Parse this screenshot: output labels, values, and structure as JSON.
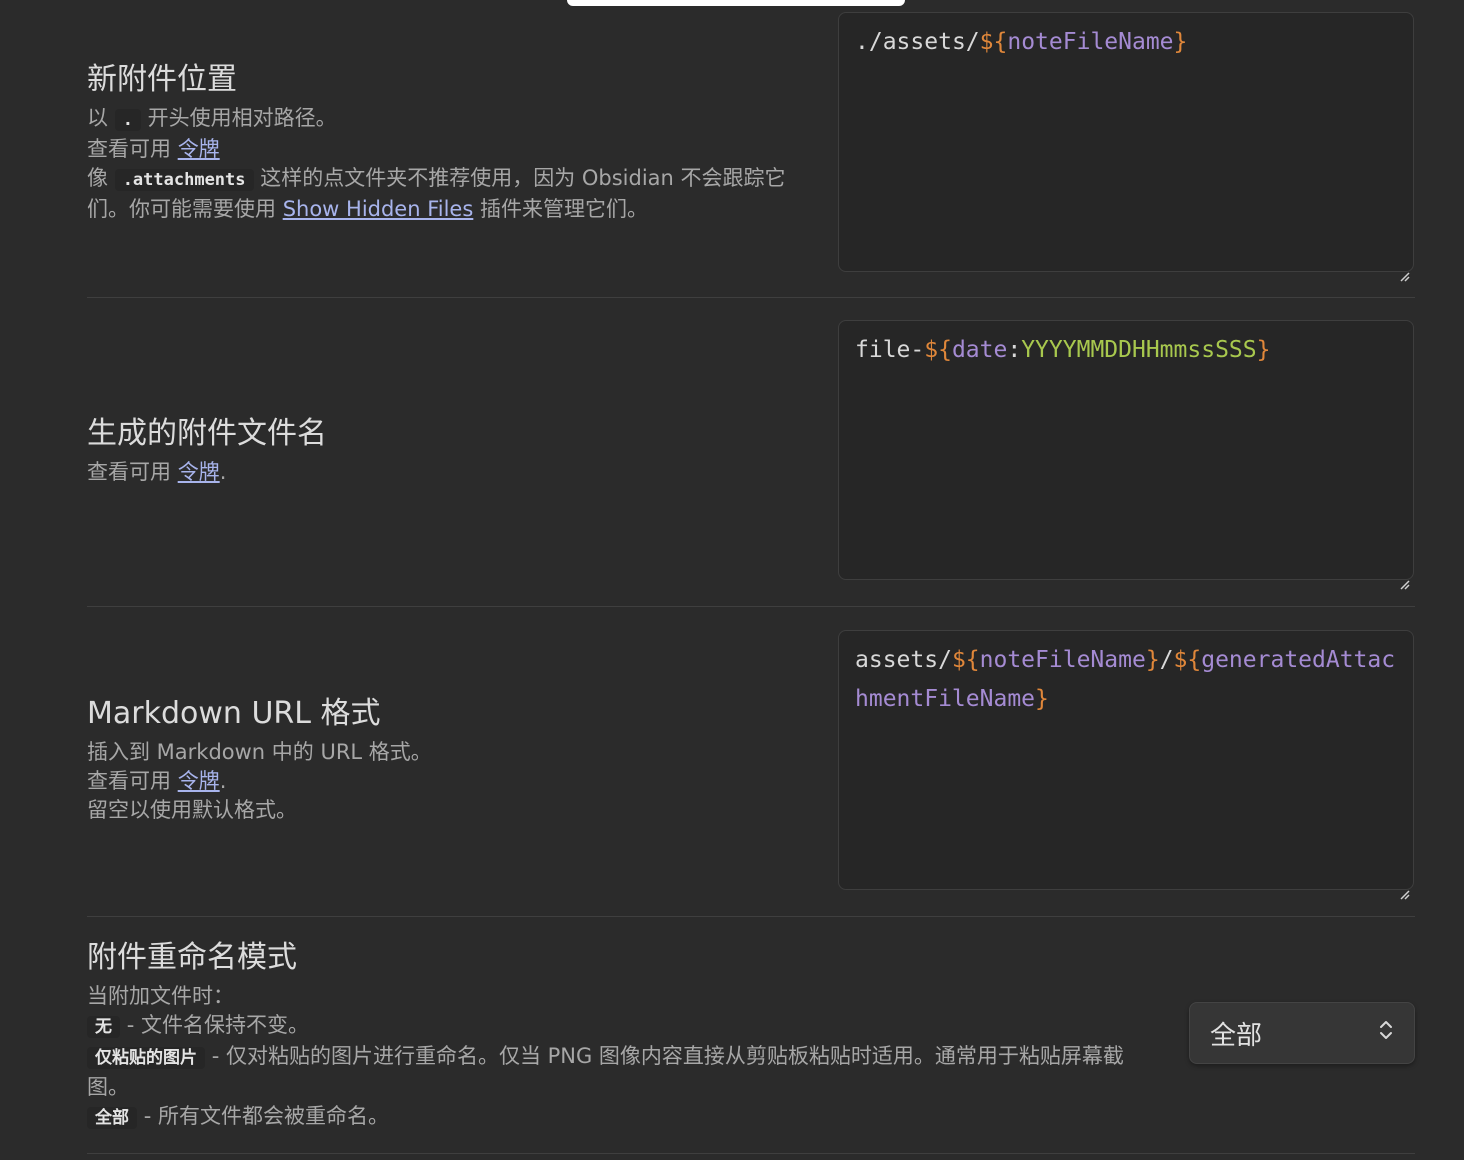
{
  "settings": [
    {
      "title": "新附件位置",
      "value_parts": [
        {
          "text": "./",
          "kind": "punct"
        },
        {
          "text": "assets",
          "kind": "punct"
        },
        {
          "text": "/",
          "kind": "punct"
        },
        {
          "text": "${",
          "kind": "delim"
        },
        {
          "text": "noteFileName",
          "kind": "var"
        },
        {
          "text": "}",
          "kind": "delim"
        }
      ],
      "desc": {
        "line1_pre": "以",
        "line1_code": ".",
        "line1_post": "开头使用相对路径。",
        "line2_pre": "查看可用",
        "line2_link": "令牌",
        "line3_pre": "像",
        "line3_code": ".attachments",
        "line3_post": "这样的点文件夹不推荐使用，因为 Obsidian 不会跟踪它们。你可能需要使用",
        "line3_link": "Show Hidden Files",
        "line3_end": "插件来管理它们。"
      }
    },
    {
      "title": "生成的附件文件名",
      "value_parts": [
        {
          "text": "file-",
          "kind": "punct"
        },
        {
          "text": "${",
          "kind": "delim"
        },
        {
          "text": "date",
          "kind": "var"
        },
        {
          "text": ":",
          "kind": "colon"
        },
        {
          "text": "YYYYMMDDHHmmssSSS",
          "kind": "fmt"
        },
        {
          "text": "}",
          "kind": "delim"
        }
      ],
      "desc": {
        "line1_pre": "查看可用",
        "line1_link": "令牌",
        "line1_end": "."
      }
    },
    {
      "title": "Markdown URL 格式",
      "value_parts": [
        {
          "text": "assets/",
          "kind": "punct"
        },
        {
          "text": "${",
          "kind": "delim"
        },
        {
          "text": "noteFileName",
          "kind": "var"
        },
        {
          "text": "}",
          "kind": "delim"
        },
        {
          "text": "/",
          "kind": "punct"
        },
        {
          "text": "${",
          "kind": "delim"
        },
        {
          "text": "generatedAttachmentFileName",
          "kind": "var"
        },
        {
          "text": "}",
          "kind": "delim"
        }
      ],
      "desc": {
        "line1": "插入到 Markdown 中的 URL 格式。",
        "line2_pre": "查看可用",
        "line2_link": "令牌",
        "line2_end": ".",
        "line3": "留空以使用默认格式。"
      }
    },
    {
      "title": "附件重命名模式",
      "desc": {
        "line1": "当附加文件时：",
        "opt1_code": "无",
        "opt1_text": "- 文件名保持不变。",
        "opt2_code": "仅粘贴的图片",
        "opt2_text": "- 仅对粘贴的图片进行重命名。仅当 PNG 图像内容直接从剪贴板粘贴时适用。通常用于粘贴屏幕截图。",
        "opt3_code": "全部",
        "opt3_text": "- 所有文件都会被重命名。"
      },
      "dropdown_value": "全部"
    }
  ],
  "colors": {
    "background": "#2b2b2b",
    "link": "#a8b4ec",
    "token_delim": "#e0873a",
    "token_var": "#a58bd3",
    "token_fmt": "#a8c84e"
  }
}
